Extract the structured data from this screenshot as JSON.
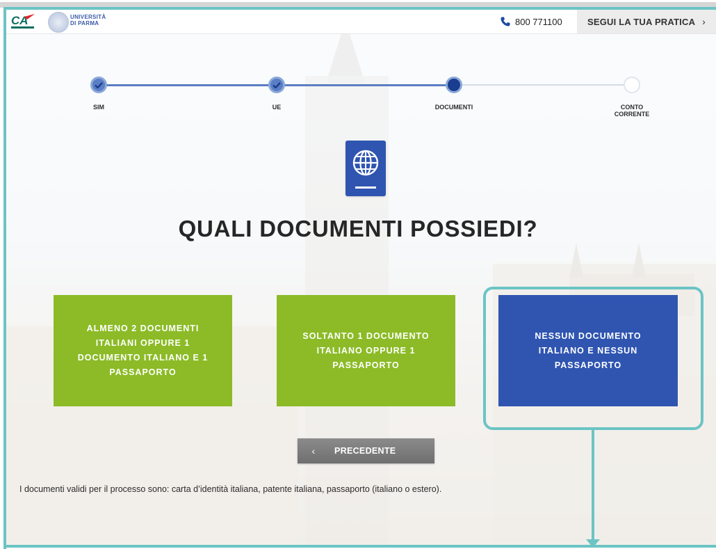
{
  "header": {
    "university_line1": "UNIVERSITÀ",
    "university_line2": "DI PARMA",
    "phone": "800 771100",
    "track_label": "SEGUI LA TUA PRATICA",
    "track_icon": "chevron-right-icon"
  },
  "stepper": {
    "steps": [
      {
        "label": "SIM",
        "state": "done"
      },
      {
        "label": "UE",
        "state": "done"
      },
      {
        "label": "DOCUMENTI",
        "state": "current"
      },
      {
        "label_line1": "CONTO",
        "label_line2": "CORRENTE",
        "state": "todo"
      }
    ]
  },
  "main": {
    "icon": "passport-globe-icon",
    "title": "QUALI DOCUMENTI POSSIEDI?",
    "options": [
      {
        "line1": "ALMENO 2 DOCUMENTI",
        "line2": "ITALIANI OPPURE 1",
        "line3": "DOCUMENTO ITALIANO E 1",
        "line4": "PASSAPORTO",
        "color": "#8cbb27"
      },
      {
        "line1": "SOLTANTO 1 DOCUMENTO",
        "line2": "ITALIANO OPPURE 1",
        "line3": "PASSAPORTO",
        "color": "#8cbb27"
      },
      {
        "line1": "NESSUN DOCUMENTO",
        "line2": "ITALIANO E NESSUN",
        "line3": "PASSAPORTO",
        "color": "#2f55b0"
      }
    ],
    "prev_label": "PRECEDENTE",
    "prev_icon": "chevron-left-icon",
    "note": "I documenti validi per il processo sono: carta d’identità italiana, patente italiana, passaporto (italiano o estero)."
  },
  "colors": {
    "accent_teal": "#6cc4c4",
    "brand_blue": "#2f55b0",
    "brand_green": "#8cbb27",
    "step_blue": "#5a7ec3"
  }
}
